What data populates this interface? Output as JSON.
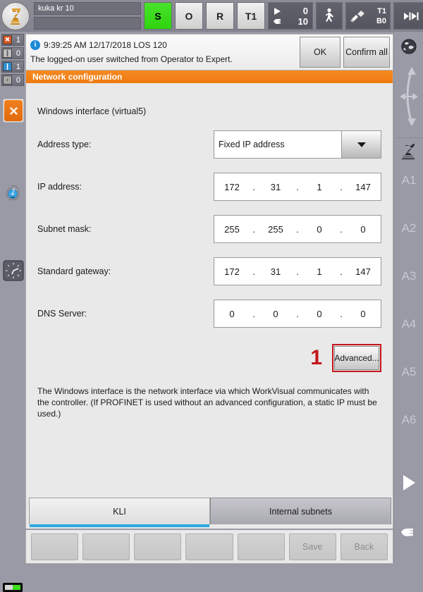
{
  "statusbar": {
    "logo_icon": "kuka-robot-icon",
    "program_name": "kuka kr 10",
    "program_name2": "",
    "buttons": [
      {
        "name": "submit-interpreter",
        "label": "S",
        "state": "green"
      },
      {
        "name": "drives-state",
        "label": "O",
        "state": "grey"
      },
      {
        "name": "robot-interpreter",
        "label": "R",
        "state": "grey"
      },
      {
        "name": "operating-mode",
        "label": "T1",
        "state": "grey"
      }
    ],
    "override": {
      "program_value": "0",
      "jog_value": "10",
      "program_icon": "play-icon",
      "jog_icon": "hand-icon"
    },
    "walk_icon": "walking-man-icon",
    "tool": {
      "icon": "tool-icon",
      "tool_label": "T1",
      "base_label": "B0"
    },
    "increment": {
      "icon": "increment-icon",
      "value": "∞"
    }
  },
  "counters": [
    {
      "name": "error-counter",
      "glyph": "✖",
      "color": "#d9541f",
      "value": "1"
    },
    {
      "name": "warning-counter",
      "glyph": "❙",
      "color": "#b9b9b9",
      "value": "0"
    },
    {
      "name": "info-counter",
      "glyph": "❙",
      "color": "#2e8fd1",
      "value": "1"
    },
    {
      "name": "waiting-counter",
      "glyph": "‹",
      "color": "#9a9a9a",
      "value": "0"
    }
  ],
  "left_icons": [
    {
      "name": "close-message-button",
      "icon": "close-x-icon"
    },
    {
      "name": "robot-settings-icon",
      "icon": "gear-robot-icon"
    },
    {
      "name": "clock-icon",
      "icon": "clock-icon"
    },
    {
      "name": "battery-indicator",
      "icon": "battery-icon"
    }
  ],
  "message": {
    "icon": "info-icon",
    "header": "9:39:25 AM 12/17/2018 LOS 120",
    "body": "The logged-on user switched from Operator to Expert.",
    "ok_label": "OK",
    "confirm_all_label": "Confirm all"
  },
  "panel": {
    "title": "Network configuration",
    "interface_label": "Windows interface (virtual5)",
    "fields": [
      {
        "name": "address-type",
        "label": "Address type:",
        "type": "combo",
        "value": "Fixed IP address"
      },
      {
        "name": "ip-address",
        "label": "IP address:",
        "type": "ip",
        "octets": [
          "172",
          "31",
          "1",
          "147"
        ]
      },
      {
        "name": "subnet-mask",
        "label": "Subnet mask:",
        "type": "ip",
        "octets": [
          "255",
          "255",
          "0",
          "0"
        ]
      },
      {
        "name": "standard-gateway",
        "label": "Standard gateway:",
        "type": "ip",
        "octets": [
          "172",
          "31",
          "1",
          "147"
        ]
      },
      {
        "name": "dns-server",
        "label": "DNS Server:",
        "type": "ip",
        "octets": [
          "0",
          "0",
          "0",
          "0"
        ]
      }
    ],
    "marker_label": "1",
    "marker_color": "#c4161c",
    "advanced_label": "Advanced...",
    "help_text": "The Windows interface is the network interface via which WorkVisual communicates with the controller. (If PROFINET is used without an advanced configuration, a static IP must be used.)"
  },
  "tabs": [
    {
      "name": "tab-kli",
      "label": "KLI",
      "active": true
    },
    {
      "name": "tab-internal-subnets",
      "label": "Internal subnets",
      "active": false
    }
  ],
  "tab_accent_color": "#29a8e0",
  "softkeys": [
    "",
    "",
    "",
    "",
    "",
    "Save",
    "Back"
  ],
  "right_column": {
    "globe_icon": "globe-icon",
    "motion_icon": "motion-arrows-icon",
    "robot_icon": "robot-axis-icon",
    "axes": [
      "A1",
      "A2",
      "A3",
      "A4",
      "A5",
      "A6"
    ],
    "play_icon": "play-triangle-icon",
    "hand_icon": "hand-icon"
  }
}
